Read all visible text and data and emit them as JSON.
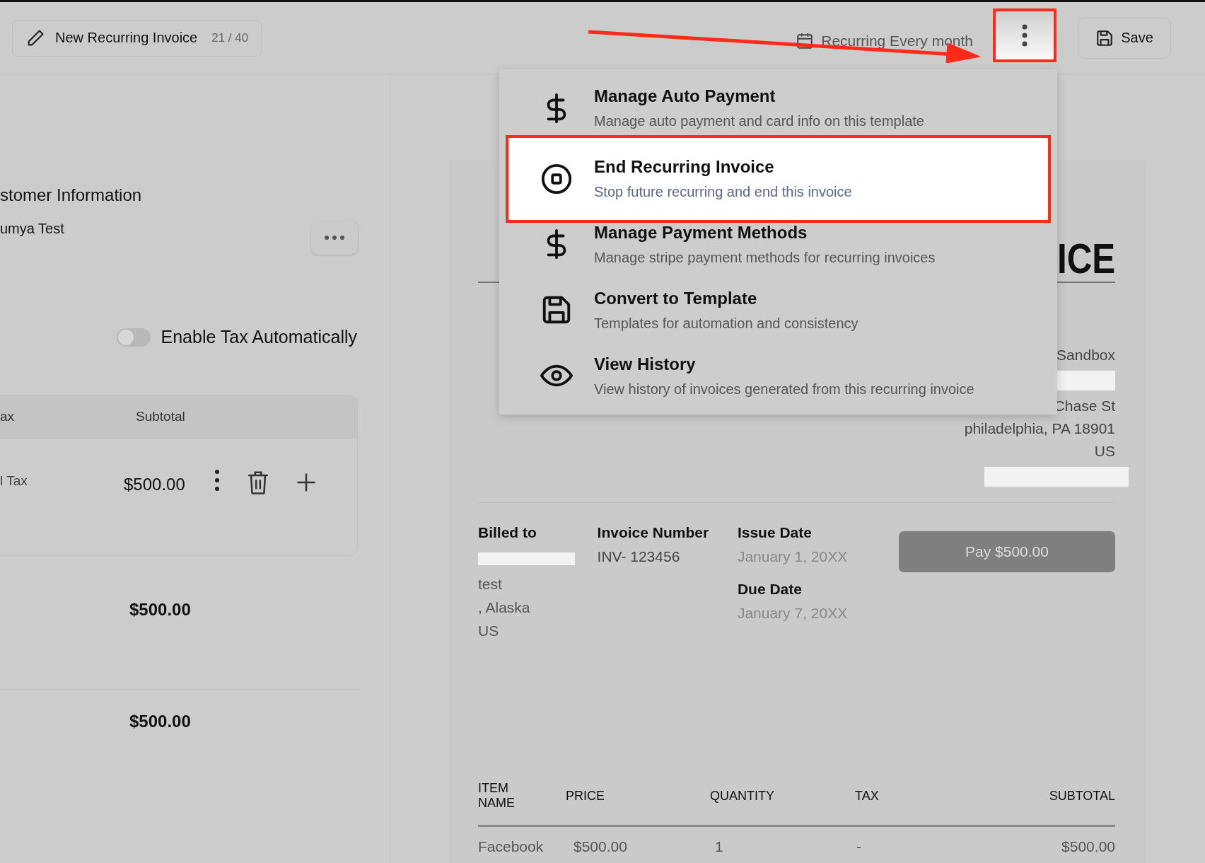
{
  "header": {
    "title": "New Recurring Invoice",
    "char_count": "21 / 40",
    "recurrence": "Recurring Every month",
    "more_button": {
      "highlighted": true
    },
    "save_button": "Save"
  },
  "left_panel": {
    "section_title": "stomer Information",
    "customer_name": "umya Test",
    "tax_toggle": {
      "label": "Enable Tax Automatically",
      "on": false
    },
    "table": {
      "columns": [
        "ax",
        "Subtotal"
      ],
      "row": {
        "tax": "l Tax",
        "subtotal": "$500.00"
      }
    },
    "totals": [
      "$500.00",
      "$500.00"
    ]
  },
  "menu": {
    "items": [
      {
        "kind": "dollar",
        "title": "Manage Auto Payment",
        "description": "Manage auto payment and card info on this template",
        "highlighted": false
      },
      {
        "kind": "stop",
        "title": "End Recurring Invoice",
        "description": "Stop future recurring and end this invoice",
        "highlighted": true
      },
      {
        "kind": "dollar",
        "title": "Manage Payment Methods",
        "description": "Manage stripe payment methods for recurring invoices",
        "highlighted": false
      },
      {
        "kind": "save",
        "title": "Convert to Template",
        "description": "Templates for automation and consistency",
        "highlighted": false
      },
      {
        "kind": "eye",
        "title": "View History",
        "description": "View history of invoices generated from this recurring invoice",
        "highlighted": false
      }
    ]
  },
  "invoice": {
    "title": "ICE",
    "sender": [
      "Sandbox",
      "Chase St",
      "philadelphia, PA 18901",
      "US"
    ],
    "billed_to": {
      "label": "Billed to",
      "lines": [
        "test",
        ", Alaska",
        "US"
      ]
    },
    "invoice_number": {
      "label": "Invoice Number",
      "value": "INV- 123456"
    },
    "issue_date": {
      "label": "Issue Date",
      "value": "January 1, 20XX"
    },
    "due_date": {
      "label": "Due Date",
      "value": "January 7, 20XX"
    },
    "pay_button": "Pay $500.00",
    "items_table": {
      "columns": [
        "ITEM NAME",
        "PRICE",
        "QUANTITY",
        "TAX",
        "SUBTOTAL"
      ],
      "rows": [
        [
          "Facebook",
          "$500.00",
          "1",
          "-",
          "$500.00"
        ]
      ]
    }
  }
}
